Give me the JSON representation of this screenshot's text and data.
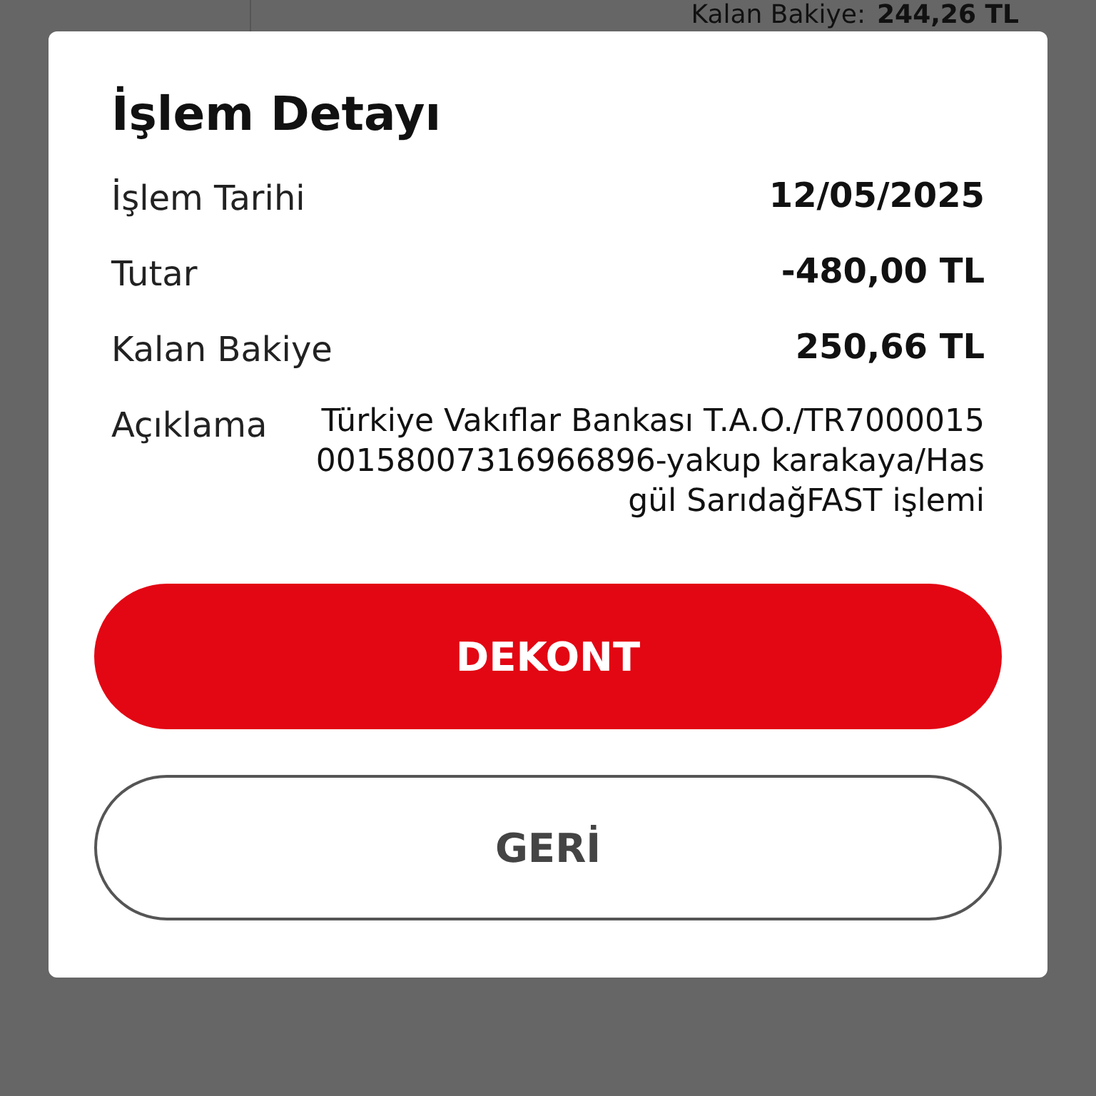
{
  "background": {
    "balance_label": "Kalan Bakiye:",
    "balance_value": "244,26 TL"
  },
  "dialog": {
    "title": "İşlem Detayı",
    "rows": [
      {
        "label": "İşlem Tarihi",
        "value": "12/05/2025",
        "kind": "bold"
      },
      {
        "label": "Tutar",
        "value": "-480,00 TL",
        "kind": "bold"
      },
      {
        "label": "Kalan Bakiye",
        "value": "250,66 TL",
        "kind": "bold"
      },
      {
        "label": "Açıklama",
        "value": "Türkiye Vakıflar Bankası T.A.O./TR700001500158007316966896-yakup karakaya/Hasgül SarıdağFAST işlemi",
        "kind": "plain"
      }
    ],
    "buttons": [
      {
        "label": "DEKONT",
        "kind": "primary"
      },
      {
        "label": "GERİ",
        "kind": "secondary"
      }
    ]
  }
}
